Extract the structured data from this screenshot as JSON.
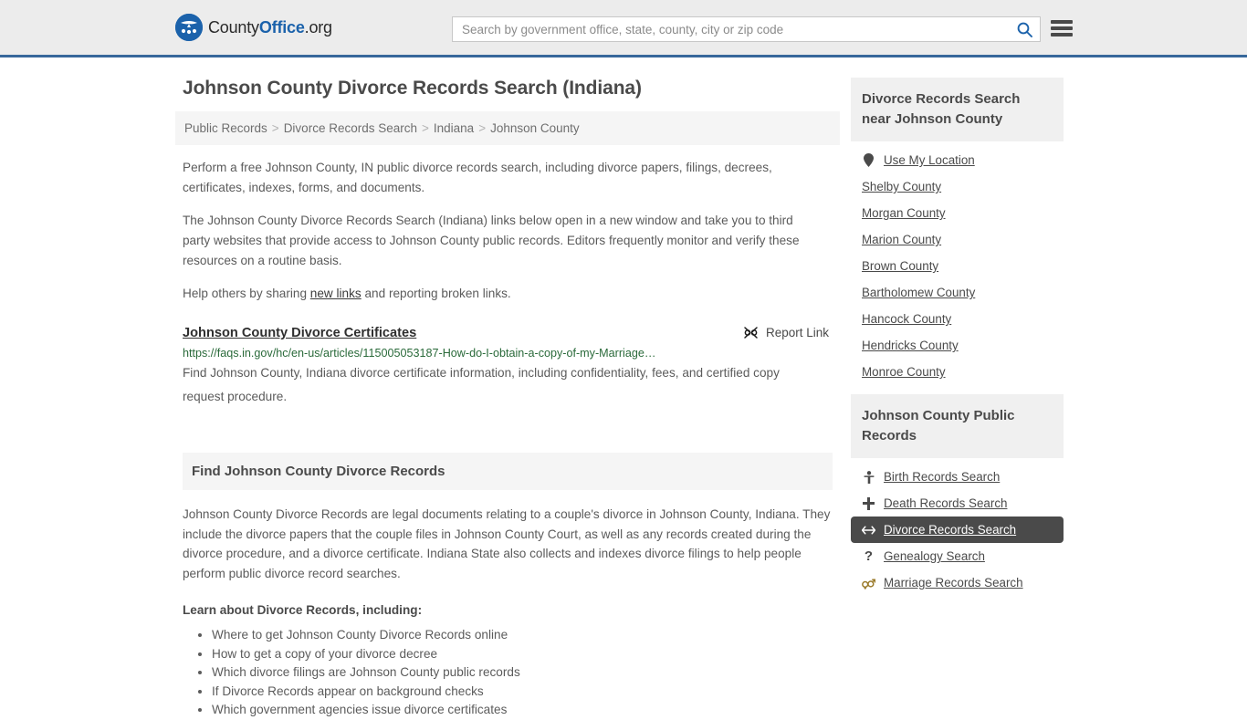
{
  "header": {
    "logo": {
      "part1": "County",
      "part2": "Office",
      "part3": ".org",
      "icon": "eagle-seal-icon"
    },
    "search": {
      "placeholder": "Search by government office, state, county, city or zip code",
      "value": ""
    },
    "search_icon": "search-icon",
    "menu_icon": "hamburger-menu-icon",
    "accent_color": "#37689b"
  },
  "main": {
    "title": "Johnson County Divorce Records Search (Indiana)",
    "breadcrumb": [
      {
        "label": "Public Records"
      },
      {
        "label": "Divorce Records Search"
      },
      {
        "label": "Indiana"
      },
      {
        "label": "Johnson County"
      }
    ],
    "breadcrumb_separator": ">",
    "intro_1": "Perform a free Johnson County, IN public divorce records search, including divorce papers, filings, decrees, certificates, indexes, forms, and documents.",
    "intro_2": "The Johnson County Divorce Records Search (Indiana) links below open in a new window and take you to third party websites that provide access to Johnson County public records. Editors frequently monitor and verify these resources on a routine basis.",
    "intro_3_before": "Help others by sharing ",
    "intro_3_link": "new links",
    "intro_3_after": " and reporting broken links.",
    "result": {
      "title": "Johnson County Divorce Certificates",
      "report_label": "Report Link",
      "report_icon": "broken-link-icon",
      "url": "https://faqs.in.gov/hc/en-us/articles/115005053187-How-do-I-obtain-a-copy-of-my-Marriage…",
      "description": "Find Johnson County, Indiana divorce certificate information, including confidentiality, fees, and certified copy request procedure.",
      "url_color": "#2a6a3a"
    },
    "section": {
      "heading": "Find Johnson County Divorce Records",
      "paragraph": "Johnson County Divorce Records are legal documents relating to a couple's divorce in Johnson County, Indiana. They include the divorce papers that the couple files in Johnson County Court, as well as any records created during the divorce procedure, and a divorce certificate. Indiana State also collects and indexes divorce filings to help people perform public divorce record searches.",
      "learn_heading": "Learn about Divorce Records, including:",
      "learn_items": [
        "Where to get Johnson County Divorce Records online",
        "How to get a copy of your divorce decree",
        "Which divorce filings are Johnson County public records",
        "If Divorce Records appear on background checks",
        "Which government agencies issue divorce certificates"
      ]
    }
  },
  "sidebar": {
    "nearby": {
      "heading": "Divorce Records Search near Johnson County",
      "items": [
        {
          "label": "Use My Location",
          "icon": "map-pin-icon"
        },
        {
          "label": "Shelby County",
          "icon": ""
        },
        {
          "label": "Morgan County",
          "icon": ""
        },
        {
          "label": "Marion County",
          "icon": ""
        },
        {
          "label": "Brown County",
          "icon": ""
        },
        {
          "label": "Bartholomew County",
          "icon": ""
        },
        {
          "label": "Hancock County",
          "icon": ""
        },
        {
          "label": "Hendricks County",
          "icon": ""
        },
        {
          "label": "Monroe County",
          "icon": ""
        }
      ]
    },
    "public_records": {
      "heading": "Johnson County Public Records",
      "active_color": "#4a4a4a",
      "items": [
        {
          "label": "Birth Records Search",
          "icon": "baby-icon",
          "glyph": "🚼",
          "active": false
        },
        {
          "label": "Death Records Search",
          "icon": "cross-icon",
          "glyph": "✚",
          "active": false
        },
        {
          "label": "Divorce Records Search",
          "icon": "divorce-arrows-icon",
          "glyph": "↔",
          "active": true
        },
        {
          "label": "Genealogy Search",
          "icon": "question-mark-icon",
          "glyph": "?",
          "active": false
        },
        {
          "label": "Marriage Records Search",
          "icon": "male-female-icon",
          "glyph": "⚥",
          "active": false
        }
      ]
    }
  }
}
